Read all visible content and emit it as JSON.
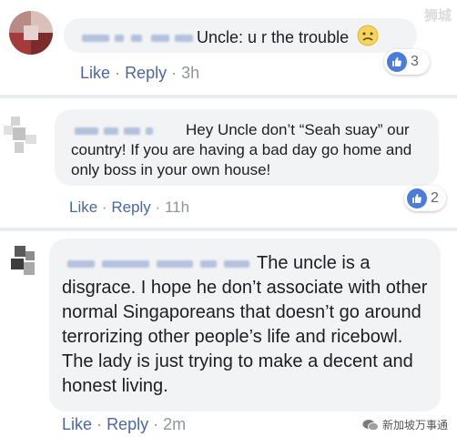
{
  "comments": [
    {
      "text": "Uncle: u r the trouble",
      "actions": {
        "like": "Like",
        "reply": "Reply",
        "sep": "·",
        "time": "3h"
      },
      "reaction_count": "3",
      "emoji": "slightly-frowning-face"
    },
    {
      "text": "Hey Uncle don’t “Seah suay” our country! If you are having a bad day go home and only boss in your own house!",
      "actions": {
        "like": "Like",
        "reply": "Reply",
        "sep": "·",
        "time": "11h"
      },
      "reaction_count": "2"
    },
    {
      "text": "The uncle is a disgrace. I hope he don’t associate with other normal Singaporeans that doesn’t go around terrorizing other people’s life and ricebowl. The lady is just trying to make a decent and honest living.",
      "actions": {
        "like": "Like",
        "reply": "Reply",
        "sep": "·",
        "time": "2m"
      }
    }
  ],
  "watermarks": {
    "top": "狮城",
    "bottom": "新加坡万事通"
  },
  "colors": {
    "link": "#4b67a1",
    "bubble": "#f2f3f5",
    "like_badge": "#4a7cdb",
    "meta": "#90949c"
  }
}
